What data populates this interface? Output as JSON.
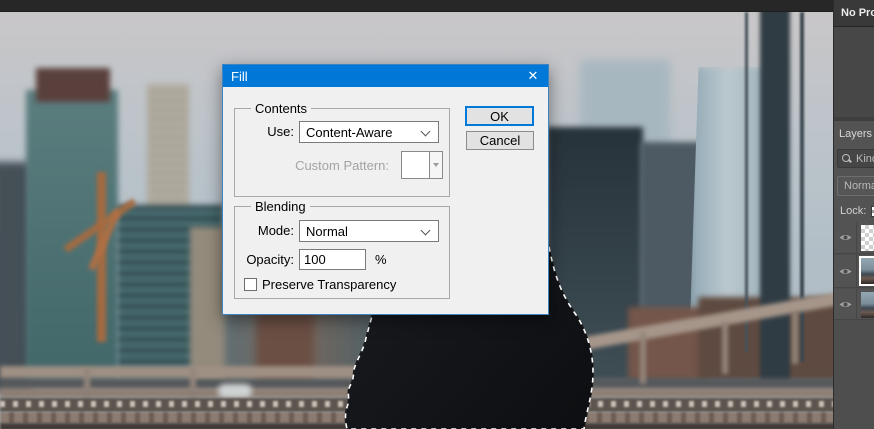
{
  "dialog": {
    "title": "Fill",
    "close_icon": "✕",
    "contents": {
      "legend": "Contents",
      "use_label": "Use:",
      "use_value": "Content-Aware",
      "custom_pattern_label": "Custom Pattern:"
    },
    "blending": {
      "legend": "Blending",
      "mode_label": "Mode:",
      "mode_value": "Normal",
      "opacity_label": "Opacity:",
      "opacity_value": "100",
      "opacity_unit": "%",
      "preserve_label": "Preserve Transparency",
      "preserve_checked": false
    },
    "buttons": {
      "ok": "OK",
      "cancel": "Cancel"
    }
  },
  "panel": {
    "properties_title": "No Pro",
    "layers_tab": "Layers",
    "filter_kind": "Kind",
    "blend_mode": "Normal",
    "lock_label": "Lock:",
    "layers": [
      {
        "thumb": "transparent",
        "visible": true,
        "selected": false
      },
      {
        "thumb": "image",
        "visible": true,
        "selected": true
      },
      {
        "thumb": "image",
        "visible": true,
        "selected": false
      }
    ]
  },
  "icons": {
    "close": "close-icon",
    "search": "magnifier-icon",
    "dropdown": "chevron-down-icon",
    "visibility": "eye-icon",
    "transparency_lock": "checkerboard-icon"
  },
  "colors": {
    "accent_blue": "#0078d7",
    "dialog_bg": "#f0f0f0",
    "panel_bg": "#535353",
    "panel_header_bg": "#393939",
    "canvas_sky": "#bcc4ca"
  }
}
